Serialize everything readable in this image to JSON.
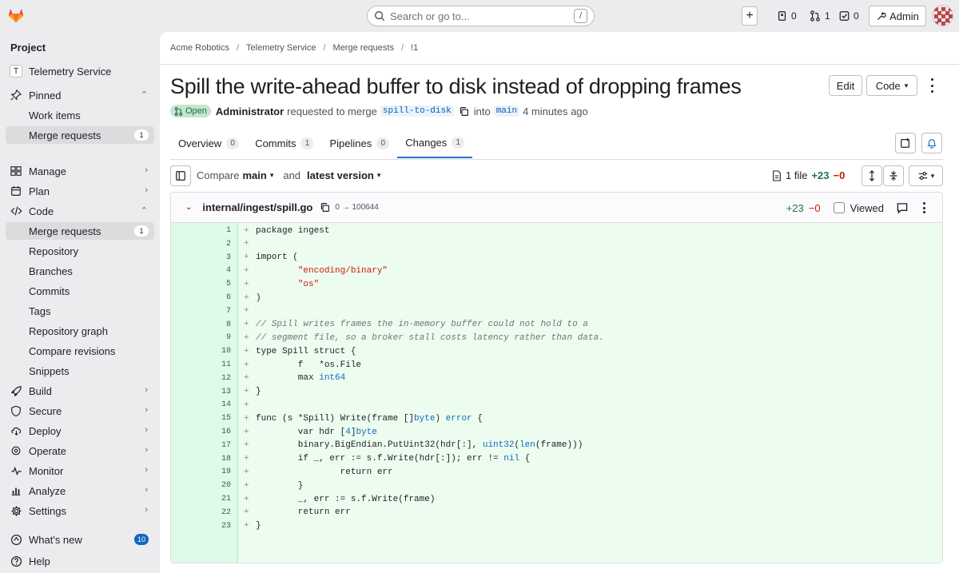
{
  "topbar": {
    "search_placeholder": "Search or go to...",
    "search_shortcut": "/",
    "issues_count": "0",
    "mr_count": "1",
    "todo_count": "0",
    "admin_label": "Admin"
  },
  "sidebar": {
    "title": "Project",
    "project_initial": "T",
    "project_name": "Telemetry Service",
    "pinned": "Pinned",
    "work_items": "Work items",
    "merge_requests_pinned": "Merge requests",
    "merge_requests_pinned_count": "1",
    "manage": "Manage",
    "plan": "Plan",
    "code": "Code",
    "code_items": [
      "Merge requests",
      "Repository",
      "Branches",
      "Commits",
      "Tags",
      "Repository graph",
      "Compare revisions",
      "Snippets"
    ],
    "code_mr_count": "1",
    "build": "Build",
    "secure": "Secure",
    "deploy": "Deploy",
    "operate": "Operate",
    "monitor": "Monitor",
    "analyze": "Analyze",
    "settings": "Settings",
    "whats_new": "What's new",
    "whats_new_count": "10",
    "help": "Help"
  },
  "breadcrumb": [
    "Acme Robotics",
    "Telemetry Service",
    "Merge requests",
    "!1"
  ],
  "mr": {
    "title": "Spill the write-ahead buffer to disk instead of dropping frames",
    "status": "Open",
    "author": "Administrator",
    "requested_text": "requested to merge",
    "source_branch": "spill-to-disk",
    "into_text": "into",
    "target_branch": "main",
    "time": "4 minutes ago",
    "edit_label": "Edit",
    "code_label": "Code"
  },
  "tabs": [
    {
      "label": "Overview",
      "count": "0"
    },
    {
      "label": "Commits",
      "count": "1"
    },
    {
      "label": "Pipelines",
      "count": "0"
    },
    {
      "label": "Changes",
      "count": "1"
    }
  ],
  "compare": {
    "compare_label": "Compare",
    "base": "main",
    "and_label": "and",
    "head": "latest version",
    "files": "1 file",
    "additions": "+23",
    "deletions": "−0"
  },
  "file": {
    "path": "internal/ingest/spill.go",
    "mode": "0 → 100644",
    "additions": "+23",
    "deletions": "−0",
    "viewed_label": "Viewed"
  },
  "code_lines": [
    "package ingest",
    "",
    "import (",
    "\t\"encoding/binary\"",
    "\t\"os\"",
    ")",
    "",
    "// Spill writes frames the in-memory buffer could not hold to a",
    "// segment file, so a broker stall costs latency rather than data.",
    "type Spill struct {",
    "\tf   *os.File",
    "\tmax int64",
    "}",
    "",
    "func (s *Spill) Write(frame []byte) error {",
    "\tvar hdr [4]byte",
    "\tbinary.BigEndian.PutUint32(hdr[:], uint32(len(frame)))",
    "\tif _, err := s.f.Write(hdr[:]); err != nil {",
    "\t\treturn err",
    "\t}",
    "\t_, err := s.f.Write(frame)",
    "\treturn err",
    "}"
  ],
  "colors": {
    "accent": "#1f75cb",
    "added_bg": "#ecfdf0",
    "open_badge": "#c3e6cd",
    "brand": "#e24329"
  }
}
